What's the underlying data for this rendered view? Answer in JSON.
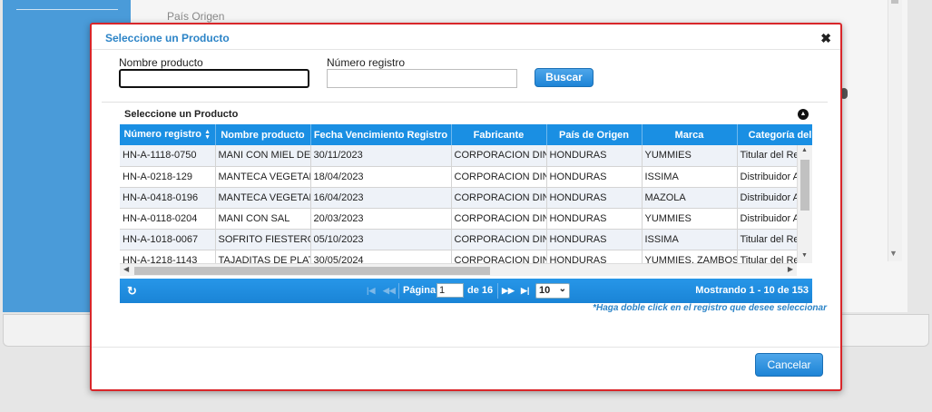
{
  "background": {
    "field_label": "País Origen"
  },
  "modal": {
    "title": "Seleccione un Producto",
    "close_icon": "close-icon",
    "search": {
      "nombre_label": "Nombre producto",
      "nombre_value": "",
      "numero_label": "Número registro",
      "numero_value": "",
      "button_label": "Buscar"
    },
    "grid": {
      "caption": "Seleccione un Producto",
      "columns": [
        "Número registro",
        "Nombre producto",
        "Fecha Vencimiento Registro",
        "Fabricante",
        "País de Origen",
        "Marca",
        "Categoría del"
      ],
      "rows": [
        [
          "HN-A-1118-0750",
          "MANI CON MIEL DE",
          "30/11/2023",
          "CORPORACION DIN",
          "HONDURAS",
          "YUMMIES",
          "Titular del Re"
        ],
        [
          "HN-A-0218-129",
          "MANTECA VEGETAL",
          "18/04/2023",
          "CORPORACION DIN",
          "HONDURAS",
          "ISSIMA",
          "Distribuidor A"
        ],
        [
          "HN-A-0418-0196",
          "MANTECA VEGETAL",
          "16/04/2023",
          "CORPORACION DIN",
          "HONDURAS",
          "MAZOLA",
          "Distribuidor A"
        ],
        [
          "HN-A-0118-0204",
          "MANI CON SAL",
          "20/03/2023",
          "CORPORACION DIN",
          "HONDURAS",
          "YUMMIES",
          "Distribuidor A"
        ],
        [
          "HN-A-1018-0067",
          "SOFRITO FIESTERO",
          "05/10/2023",
          "CORPORACION DIN",
          "HONDURAS",
          "ISSIMA",
          "Titular del Re"
        ],
        [
          "HN-A-1218-1143",
          "TAJADITAS DE PLAT",
          "30/05/2024",
          "CORPORACION DIN",
          "HONDURAS",
          "YUMMIES, ZAMBOS",
          "Titular del Re"
        ]
      ]
    },
    "pager": {
      "page_label": "Página",
      "page_value": "1",
      "of_label": "de 16",
      "page_size": "10",
      "records": "Mostrando 1 - 10 de 153"
    },
    "hint": "*Haga doble click en el registro que desee seleccionar",
    "cancel_label": "Cancelar"
  },
  "colors": {
    "accent": "#1a8fe3",
    "title": "#2c84c7",
    "modal_border": "#d9262a"
  }
}
